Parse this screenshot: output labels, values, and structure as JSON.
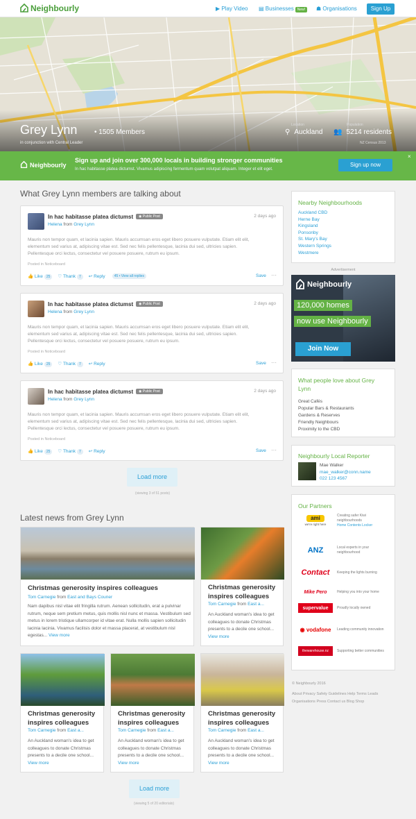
{
  "nav": {
    "brand": "Neighbourly",
    "play_video": "Play Video",
    "businesses": "Businesses",
    "new_badge": "New!",
    "organisations": "Organisations",
    "signup": "Sign Up"
  },
  "hero": {
    "title": "Grey Lynn",
    "members": "1505 Members",
    "subtitle": "in conjunction with Central Leader",
    "location": "Auckland",
    "residents": "5214 residents",
    "census": "NZ Census 2013",
    "location_label": "Location",
    "population_label": "Population"
  },
  "banner": {
    "brand": "Neighbourly",
    "title": "Sign up and join over 300,000 locals in building stronger communities",
    "text": "In hac habitasse platea dictumst. Vivamus adipiscing fermentum quam volutpat aliquam. Integer et elit eget.",
    "button": "Sign up now",
    "close": "×"
  },
  "talk": {
    "title": "What Grey Lynn members are talking about"
  },
  "posts": [
    {
      "title": "In hac habitasse platea dictumst",
      "badge": "Public Post",
      "date": "2 days ago",
      "author": "Helena",
      "from": "from",
      "place": "Grey Lynn",
      "body": "Mauris non tempor quam, et lacinia sapien. Mauris accumsan eros eget libero posuere vulputate. Etiam elit elit, elementum sed varius at, adipiscing vitae est. Sed nec felis pellentesque, lacinia dui sed, ultricies sapien. Pellentesque orci lectus, consectetur vel posuere posuere, rutrum eu ipsum.",
      "posted": "Posted in Noticeboard",
      "like": "Like",
      "like_count": "25",
      "thank": "Thank",
      "thank_count": "7",
      "reply": "Reply",
      "reply_count": "45",
      "view_all": "View all replies",
      "save": "Save"
    },
    {
      "title": "In hac habitasse platea dictumst",
      "badge": "Public Post",
      "date": "2 days ago",
      "author": "Helena",
      "from": "from",
      "place": "Grey Lynn",
      "body": "Mauris non tempor quam, et lacinia sapien. Mauris accumsan eros eget libero posuere vulputate. Etiam elit elit, elementum sed varius at, adipiscing vitae est. Sed nec felis pellentesque, lacinia dui sed, ultricies sapien. Pellentesque orci lectus, consectetur vel posuere posuere, rutrum eu ipsum.",
      "posted": "Posted in Noticeboard",
      "like": "Like",
      "like_count": "25",
      "thank": "Thank",
      "thank_count": "7",
      "reply": "Reply",
      "save": "Save"
    },
    {
      "title": "In hac habitasse platea dictumst",
      "badge": "Public Post",
      "date": "2 days ago",
      "author": "Helena",
      "from": "from",
      "place": "Grey Lynn",
      "body": "Mauris non tempor quam, et lacinia sapien. Mauris accumsan eros eget libero posuere vulputate. Etiam elit elit, elementum sed varius at, adipiscing vitae est. Sed nec felis pellentesque, lacinia dui sed, ultricies sapien. Pellentesque orci lectus, consectetur vel posuere posuere, rutrum eu ipsum.",
      "posted": "Posted in Noticeboard",
      "like": "Like",
      "like_count": "25",
      "thank": "Thank",
      "thank_count": "7",
      "reply": "Reply",
      "save": "Save"
    }
  ],
  "posts_more": {
    "button": "Load more",
    "viewing": "(viewing 3 of 51 posts)"
  },
  "news": {
    "title": "Latest news from Grey Lynn",
    "feature": {
      "title": "Christmas generosity inspires colleagues",
      "author": "Tom Carnegie",
      "from": "from",
      "place": "East and Bays Couner",
      "body": "Nam dapibus nisl vitae elit fringilla rutrum. Aenean sollicitudin, erat a pulvinar rutrum, neque sem pretium metus, quis mollis nisl nunc et massa. Vestibulum sed metus in lorem tristique ullamcorper id vitae erat. Nulla mollis sapien sollicitudin lacinia lacinia. Vivamus facilisis dolor et massa placerat, at vestibulum nisl egestas...",
      "more": "View more"
    },
    "cards": [
      {
        "title": "Christmas generosity inspires colleagues",
        "author": "Tom Carnegie",
        "from": "from",
        "place": "East a...",
        "body": "An Auckland woman's idea to get colleagues to donate Christmas presents to a decile one school...",
        "more": "View more"
      },
      {
        "title": "Christmas generosity inspires colleagues",
        "author": "Tom Carnegie",
        "from": "from",
        "place": "East a...",
        "body": "An Auckland woman's idea to get colleagues to donate Christmas presents to a decile one school...",
        "more": "View more"
      },
      {
        "title": "Christmas generosity inspires colleagues",
        "author": "Tom Carnegie",
        "from": "from",
        "place": "East a...",
        "body": "An Auckland woman's idea to get colleagues to donate Christmas presents to a decile one school...",
        "more": "View more"
      },
      {
        "title": "Christmas generosity inspires colleagues",
        "author": "Tom Carnegie",
        "from": "from",
        "place": "East a...",
        "body": "An Auckland woman's idea to get colleagues to donate Christmas presents to a decile one school...",
        "more": "View more"
      }
    ],
    "button": "Load more",
    "viewing": "(viewing 5 of 20 editorials)"
  },
  "nearby": {
    "title": "Nearby Neighbourhoods",
    "items": [
      "Auckland CBD",
      "Herne Bay",
      "Kingsland",
      "Ponsonby",
      "St. Mary's Bay",
      "Western Springs",
      "Westmere"
    ]
  },
  "ad": {
    "label": "Advertisement",
    "brand": "Neighbourly",
    "line1": "120,000 homes",
    "line2": "now use Neighbourly",
    "button": "Join Now"
  },
  "love": {
    "title": "What people love about Grey Lynn",
    "items": [
      "Great Cafés",
      "Popular Bars & Restaurants",
      "Gardens & Reserves",
      "Friendly Neighbours",
      "Proximity to the CBD"
    ]
  },
  "reporter": {
    "title": "Neighbourly Local Reporter",
    "name": "Mae Walker",
    "email": "mae_walker@conn.name",
    "phone": "022 123 4567"
  },
  "partners": {
    "title": "Our Partners",
    "items": [
      {
        "logo": "ami",
        "tag": "we're right here",
        "text": "Creating safer Kiwi neighbourhoods",
        "link": "Home Contents Locker",
        "color": "#f7c600"
      },
      {
        "logo": "ANZ",
        "text": "Local experts in your neighbourhood",
        "color": "#0072c6"
      },
      {
        "logo": "Contact",
        "text": "Keeping the lights burning",
        "color": "#e0001a"
      },
      {
        "logo": "Mike Pero",
        "text": "Helping you into your home",
        "color": "#e0001a"
      },
      {
        "logo": "supervalue",
        "text": "Proudly locally owned",
        "color": "#e0001a"
      },
      {
        "logo": "vodafone",
        "text": "Leading community innovation",
        "color": "#e60000"
      },
      {
        "logo": "thewarehouse.nz",
        "text": "Supporting better communities",
        "color": "#d2001e"
      }
    ]
  },
  "footer": {
    "copy": "© Neighbourly 2016",
    "links1": "About  Privacy  Safety  Guidelines  Help  Terms  Leads",
    "links2": "Organisations  Press  Contact us  Blog  Shop"
  }
}
